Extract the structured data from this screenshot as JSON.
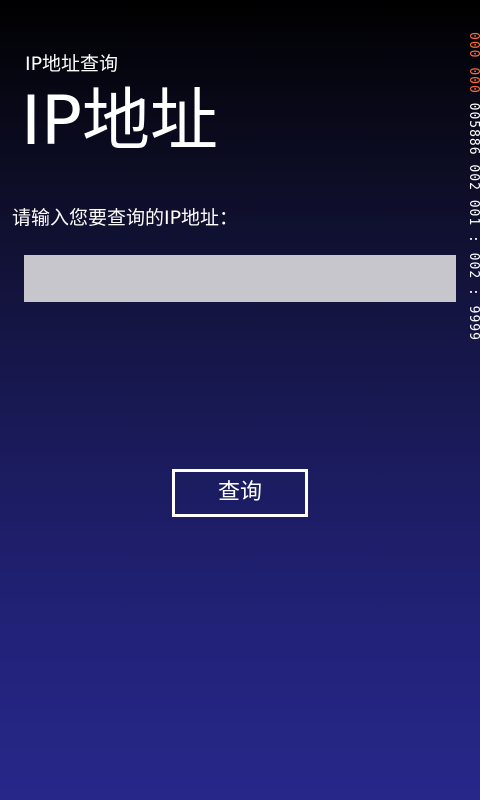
{
  "header": {
    "app_title": "IP地址查询",
    "page_title": "IP地址"
  },
  "form": {
    "prompt": "请输入您要查询的IP地址：",
    "ip_value": "",
    "ip_placeholder": ""
  },
  "actions": {
    "query_label": "查询"
  },
  "debug_counter": {
    "part1": "000",
    "part2": "000",
    "part3": "005886 002 001 : 002 : 9999"
  },
  "colors": {
    "background_top": "#000000",
    "background_bottom": "#27278a",
    "input_background": "#c6c6cc",
    "text": "#ffffff",
    "counter_highlight": "#ff6a3a"
  }
}
